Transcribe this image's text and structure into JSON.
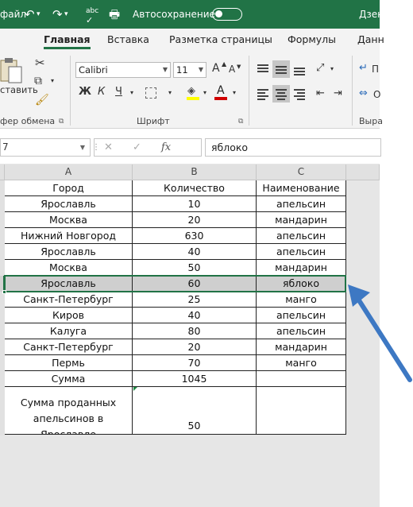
{
  "titlebar": {
    "file_tab": "файл",
    "abc_label": "abc",
    "autosave_label": "Автосохранение",
    "user_partial": "Дзен"
  },
  "ribbon_tabs": [
    {
      "label": "Главная",
      "active": true
    },
    {
      "label": "Вставка",
      "active": false
    },
    {
      "label": "Разметка страницы",
      "active": false
    },
    {
      "label": "Формулы",
      "active": false
    },
    {
      "label": "Данн",
      "active": false
    }
  ],
  "clipboard": {
    "paste_label": "ставить",
    "group_label": "фер обмена"
  },
  "font": {
    "family": "Calibri",
    "size": "11",
    "bold": "Ж",
    "italic": "К",
    "underline": "Ч",
    "grow": "A",
    "shrink": "A",
    "group_label": "Шрифт",
    "highlight_color": "#ffff00",
    "font_color": "#d00000"
  },
  "alignment": {
    "group_label_partial": "Выра",
    "wrap_partial": "П",
    "merge_partial": "О"
  },
  "formula_bar": {
    "name_box": "7",
    "cancel": "✕",
    "enter": "✓",
    "fx": "fx",
    "value": "яблоко"
  },
  "columns": [
    "A",
    "B",
    "C"
  ],
  "table": {
    "headers": [
      "Город",
      "Количество",
      "Наименование"
    ],
    "rows": [
      [
        "Ярославль",
        "10",
        "апельсин"
      ],
      [
        "Москва",
        "20",
        "мандарин"
      ],
      [
        "Нижний Новгород",
        "630",
        "апельсин"
      ],
      [
        "Ярославль",
        "40",
        "апельсин"
      ],
      [
        "Москва",
        "50",
        "мандарин"
      ],
      [
        "Ярославль",
        "60",
        "яблоко"
      ],
      [
        "Санкт-Петербург",
        "25",
        "манго"
      ],
      [
        "Киров",
        "40",
        "апельсин"
      ],
      [
        "Калуга",
        "80",
        "апельсин"
      ],
      [
        "Санкт-Петербург",
        "20",
        "мандарин"
      ],
      [
        "Пермь",
        "70",
        "манго"
      ]
    ],
    "sum_row": [
      "Сумма",
      "1045",
      ""
    ],
    "summary_row": [
      "Сумма проданных апельсинов в Ярославле",
      "50",
      ""
    ]
  },
  "colors": {
    "excel_green": "#217346",
    "arrow_blue": "#3d78c3"
  }
}
